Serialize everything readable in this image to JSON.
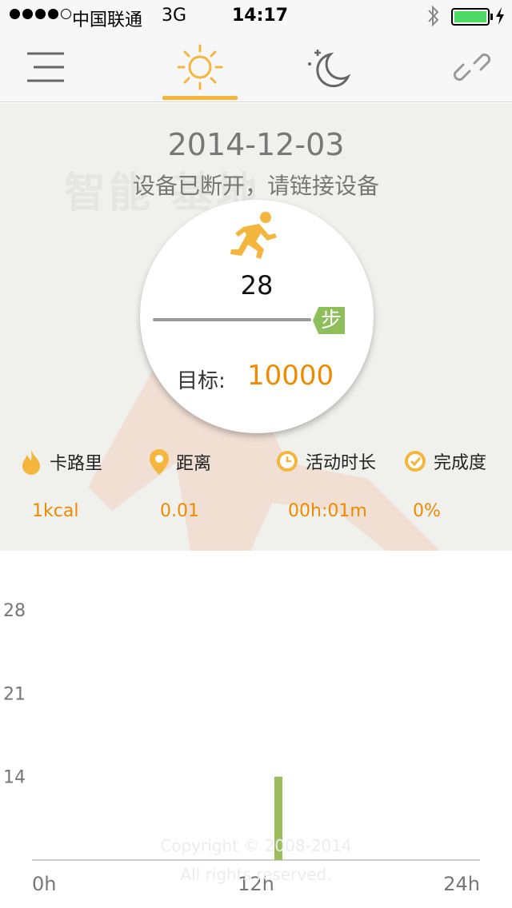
{
  "status_bar": {
    "carrier": "中国联通",
    "network": "3G",
    "time": "14:17",
    "battery_level": 1.0
  },
  "nav": {
    "items": [
      {
        "icon": "menu-icon"
      },
      {
        "icon": "sun-icon",
        "active": true
      },
      {
        "icon": "moon-icon"
      },
      {
        "icon": "link-icon"
      }
    ],
    "accent_color": "#f4b63c"
  },
  "summary": {
    "date": "2014-12-03",
    "status_message": "设备已断开，请链接设备",
    "watermark": "智能                    基地",
    "steps": "28",
    "step_unit": "步",
    "step_progress": 0.0028,
    "goal_label": "目标:",
    "goal_value": "10000"
  },
  "stats": [
    {
      "icon": "flame-icon",
      "label": "卡路里",
      "value": "1kcal"
    },
    {
      "icon": "location-pin-icon",
      "label": "距离",
      "value": "0.01"
    },
    {
      "icon": "clock-icon",
      "label": "活动时长",
      "value": "00h:01m"
    },
    {
      "icon": "check-circle-icon",
      "label": "完成度",
      "value": "0%"
    }
  ],
  "footer": {
    "copyright_line1": "Copyright © 2008-2014",
    "copyright_line2": "All rights reserved."
  },
  "chart_data": {
    "type": "bar",
    "x_tick_labels": [
      "0h",
      "12h",
      "24h"
    ],
    "y_tick_labels": [
      "14",
      "21",
      "28"
    ],
    "xlim": [
      0,
      24
    ],
    "ylim": [
      7,
      28
    ],
    "bars": [
      {
        "x": 13.2,
        "y": 14
      }
    ],
    "bar_color": "#9bbd5c",
    "grid": false
  }
}
